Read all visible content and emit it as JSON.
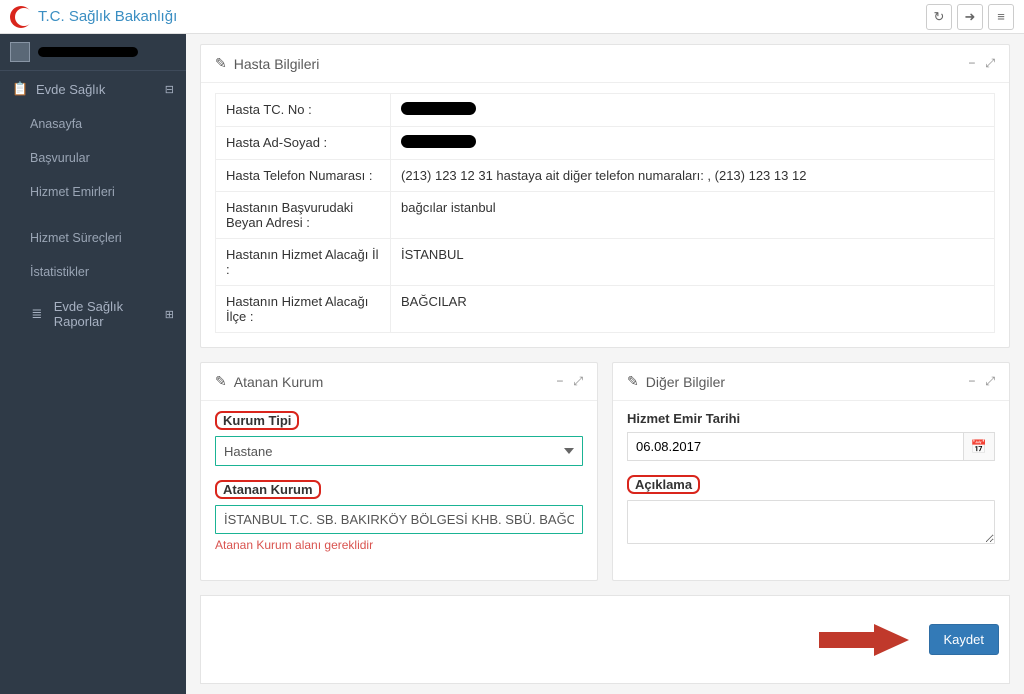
{
  "brand": "T.C. Sağlık Bakanlığı",
  "sidebar": {
    "user_name": "████████",
    "top_label": "Evde Sağlık",
    "items": [
      {
        "label": "Anasayfa"
      },
      {
        "label": "Başvurular"
      },
      {
        "label": "Hizmet Emirleri"
      }
    ],
    "items2": [
      {
        "label": "Hizmet Süreçleri"
      },
      {
        "label": "İstatistikler"
      }
    ],
    "reports_label": "Evde Sağlık Raporlar"
  },
  "patient_panel": {
    "title": "Hasta Bilgileri",
    "rows": [
      {
        "label": "Hasta TC. No :",
        "value_redacted": true
      },
      {
        "label": "Hasta Ad-Soyad :",
        "value_redacted": true
      },
      {
        "label": "Hasta Telefon Numarası :",
        "value": "(213) 123 12 31 hastaya ait diğer telefon numaraları: , (213) 123 13 12"
      },
      {
        "label": "Hastanın Başvurudaki Beyan Adresi :",
        "value": "bağcılar istanbul"
      },
      {
        "label": "Hastanın Hizmet Alacağı İl :",
        "value": "İSTANBUL"
      },
      {
        "label": "Hastanın Hizmet Alacağı İlçe :",
        "value": "BAĞCILAR"
      }
    ]
  },
  "assigned_panel": {
    "title": "Atanan Kurum",
    "type_label": "Kurum Tipi",
    "type_value": "Hastane",
    "name_label": "Atanan Kurum",
    "name_value": "İSTANBUL T.C. SB. BAKIRKÖY BÖLGESİ KHB. SBÜ. BAĞCILAR EĞİTİM VE AR",
    "error": "Atanan Kurum alanı gereklidir"
  },
  "other_panel": {
    "title": "Diğer Bilgiler",
    "date_label": "Hizmet Emir Tarihi",
    "date_value": "06.08.2017",
    "desc_label": "Açıklama",
    "desc_value": ""
  },
  "save_label": "Kaydet",
  "icons": {
    "refresh": "↻",
    "logout": "➜",
    "menu": "≡",
    "edit": "✎",
    "minus": "−",
    "expand": "⤢",
    "clipboard": "📋",
    "list": "≣",
    "calendar": "📅",
    "collapse": "⊟",
    "plus": "⊞"
  }
}
